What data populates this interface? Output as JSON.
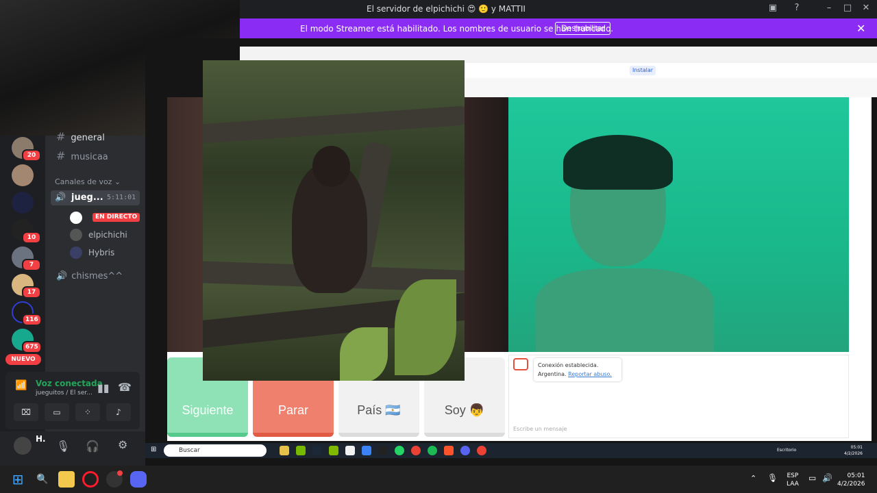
{
  "window": {
    "title": "El servidor de elpichichi 😍 🙂 y MATTII",
    "streamer_message": "El modo Streamer está habilitado. Los nombres de usuario se han truncado.",
    "disable_label": "Deshabilitar"
  },
  "servers": {
    "badges": [
      "20",
      "10",
      "7",
      "17",
      "116",
      "675"
    ],
    "new_label": "NUEVO"
  },
  "sidebar": {
    "channels": [
      {
        "name": "general"
      },
      {
        "name": "musicaa"
      }
    ],
    "voice_section": "Canales de voz",
    "active_voice": {
      "name": "jueg...",
      "time": "5:11:01"
    },
    "live_label": "EN DIRECTO",
    "members": [
      {
        "name": "elpichichi"
      },
      {
        "name": "Hybris"
      }
    ],
    "other_voice": "chismes^^"
  },
  "voice_panel": {
    "status": "Voz conectada",
    "channel": "jueguitos / El ser..."
  },
  "user_panel": {
    "username": "H."
  },
  "browser": {
    "install_label": "Instalar",
    "buttons": {
      "next": "Siguiente",
      "stop": "Parar",
      "country": "País 🇦🇷",
      "soy": "Soy 👦"
    },
    "chat": {
      "connection": "Conexión establecida.",
      "country": "Argentina.",
      "report": "Reportar abuso.",
      "placeholder": "Escribe un mensaje"
    }
  },
  "inner_taskbar": {
    "search": "Buscar",
    "desktop": "Escritorio",
    "time": "05:01",
    "date": "4/2/2026"
  },
  "taskbar": {
    "lang": "ESP",
    "layout": "LAA",
    "time": "05:01",
    "date": "4/2/2026"
  }
}
